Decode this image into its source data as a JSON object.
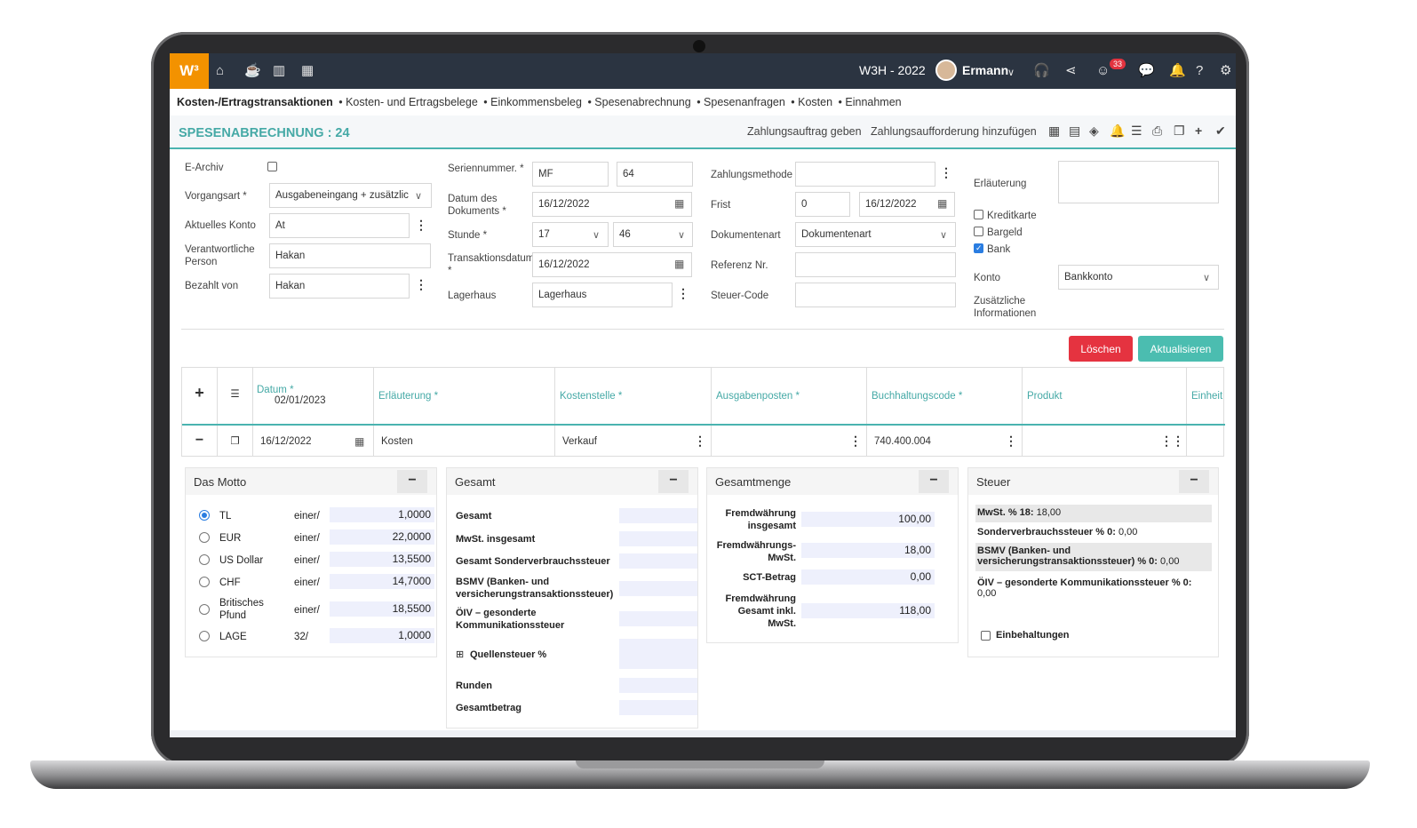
{
  "topbar": {
    "logo": "W³",
    "company": "W3H - 2022",
    "user": "Ermann",
    "notif_count": "33"
  },
  "tabs": [
    {
      "label": "Kosten-/Ertragstransaktionen"
    },
    {
      "label": "• Kosten- und Ertragsbelege"
    },
    {
      "label": "• Einkommensbeleg"
    },
    {
      "label": "• Spesenabrechnung"
    },
    {
      "label": "• Spesenanfragen"
    },
    {
      "label": "• Kosten"
    },
    {
      "label": "• Einnahmen"
    }
  ],
  "page": {
    "title": "SPESENABRECHNUNG : 24",
    "link1": "Zahlungsauftrag geben",
    "link2": "Zahlungsaufforderung hinzufügen"
  },
  "form": {
    "e_archiv": "E-Archiv",
    "vorgangsart_label": "Vorgangsart *",
    "vorgangsart": "Ausgabeneingang + zusätzlic",
    "konto_label": "Aktuelles Konto",
    "konto": "At",
    "verant_label": "Verantwortliche Person",
    "verant": "Hakan",
    "bezahlt_label": "Bezahlt von",
    "bezahlt": "Hakan",
    "serien_label": "Seriennummer. *",
    "serie": "MF",
    "nummer": "64",
    "datum_label": "Datum des Dokuments *",
    "datum": "16/12/2022",
    "stunde_label": "Stunde *",
    "stunde": "17",
    "minute": "46",
    "trans_label": "Transaktionsdatum *",
    "trans": "16/12/2022",
    "lager_label": "Lagerhaus",
    "lager": "Lagerhaus",
    "zahl_label": "Zahlungsmethode",
    "zahl": "",
    "frist_label": "Frist",
    "frist": "0",
    "frist_datum": "16/12/2022",
    "dokart_label": "Dokumentenart",
    "dokart": "Dokumentenart",
    "ref_label": "Referenz Nr.",
    "ref": "",
    "steuer_label": "Steuer-Code",
    "steuer": "",
    "erl_label": "Erläuterung",
    "erl": "",
    "kredit": "Kreditkarte",
    "bargeld": "Bargeld",
    "bank": "Bank",
    "konto2_label": "Konto",
    "konto2": "Bankkonto",
    "zusatz_label": "Zusätzliche Informationen"
  },
  "buttons": {
    "delete": "Löschen",
    "update": "Aktualisieren"
  },
  "grid": {
    "headers": {
      "datum": "Datum *",
      "datum_val": "02/01/2023",
      "erl": "Erläuterung *",
      "kst": "Kostenstelle *",
      "ausg": "Ausgabenposten *",
      "buch": "Buchhaltungscode *",
      "prod": "Produkt",
      "einh": "Einheit"
    },
    "row": {
      "datum": "16/12/2022",
      "erl": "Kosten",
      "kst": "Verkauf",
      "ausg": "",
      "buch": "740.400.004",
      "prod": ""
    }
  },
  "motto": {
    "title": "Das Motto",
    "rows": [
      {
        "name": "TL",
        "unit": "einer/",
        "value": "1,0000"
      },
      {
        "name": "EUR",
        "unit": "einer/",
        "value": "22,0000"
      },
      {
        "name": "US Dollar",
        "unit": "einer/",
        "value": "13,5500"
      },
      {
        "name": "CHF",
        "unit": "einer/",
        "value": "14,7000"
      },
      {
        "name": "Britisches Pfund",
        "unit": "einer/",
        "value": "18,5500"
      },
      {
        "name": "LAGE",
        "unit": "32/",
        "value": "1,0000"
      }
    ]
  },
  "gesamt": {
    "title": "Gesamt",
    "rows": [
      {
        "label": "Gesamt"
      },
      {
        "label": "MwSt. insgesamt"
      },
      {
        "label": "Gesamt Sonderverbrauchssteuer"
      },
      {
        "label": "BSMV (Banken- und versicherungstransaktionssteuer)"
      },
      {
        "label": "ÖIV – gesonderte Kommunikationssteuer"
      },
      {
        "label": "Quellensteuer %"
      },
      {
        "label": "Runden"
      },
      {
        "label": "Gesamtbetrag"
      }
    ]
  },
  "menge": {
    "title": "Gesamtmenge",
    "rows": [
      {
        "label": "Fremdwährung insgesamt",
        "value": "100,00"
      },
      {
        "label": "Fremdwährungs-MwSt.",
        "value": "18,00"
      },
      {
        "label": "SCT-Betrag",
        "value": "0,00"
      },
      {
        "label": "Fremdwährung Gesamt inkl. MwSt.",
        "value": "118,00"
      }
    ]
  },
  "steuer": {
    "title": "Steuer",
    "r1b": "MwSt. % 18:",
    "r1v": " 18,00",
    "r2b": "Sonderverbrauchssteuer % 0:",
    "r2v": " 0,00",
    "r3b": "BSMV (Banken- und versicherungstransaktionssteuer) % 0:",
    "r3v": " 0,00",
    "r4b": "ÖIV – gesonderte Kommunikationssteuer % 0:",
    "r4v": " 0,00",
    "einbeh": "Einbehaltungen"
  }
}
